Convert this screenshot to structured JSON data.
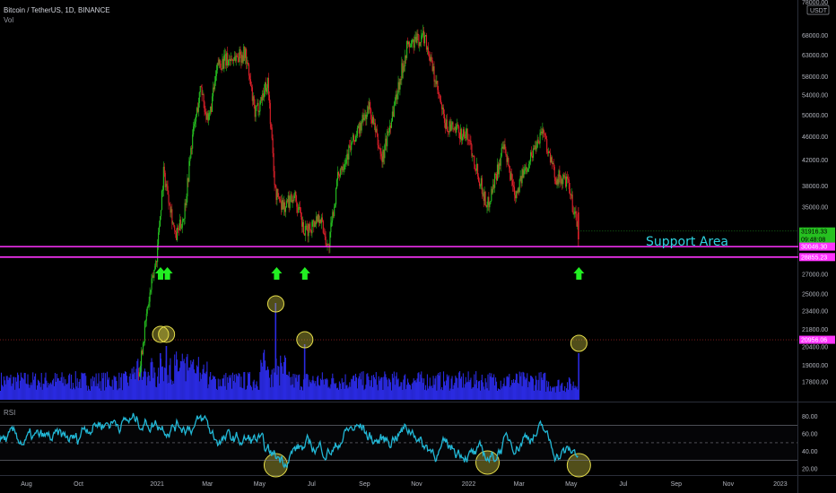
{
  "header": {
    "symbol": "Bitcoin / TetherUS, 1D, BINANCE",
    "volume_label": "Vol",
    "rsi_label": "RSI"
  },
  "price_axis": {
    "currency_badge": "USDT",
    "top_label": "78000.00",
    "ticks": [
      "68000.00",
      "63000.00",
      "58000.00",
      "54000.00",
      "50000.00",
      "46000.00",
      "42000.00",
      "38000.00",
      "35000.00",
      "27000.00",
      "25000.00",
      "23400.00",
      "21800.00",
      "20400.00",
      "19000.00",
      "17800.00"
    ]
  },
  "price_tags": [
    {
      "value": "31916.33",
      "sub": "09:48:08",
      "color": "#26c020"
    },
    {
      "value": "30046.30",
      "color": "#ff33ff"
    },
    {
      "value": "28855.23",
      "color": "#ff33ff"
    },
    {
      "value": "20956.06",
      "color": "#ff33ff"
    }
  ],
  "annotation": {
    "text": "Support Area",
    "color": "#2fd3e0"
  },
  "rsi_axis": {
    "ticks": [
      "80.00",
      "60.00",
      "40.00",
      "20.00"
    ]
  },
  "time_axis": {
    "labels": [
      "Aug",
      "Oct",
      "2021",
      "Mar",
      "May",
      "Jul",
      "Sep",
      "Nov",
      "2022",
      "Mar",
      "May",
      "Jul",
      "Sep",
      "Nov",
      "2023"
    ]
  },
  "colors": {
    "up": "#26c020",
    "down": "#e0202a",
    "support": "#ff33ff",
    "volume": "#2a2ae0",
    "rsi": "#22b8d6",
    "circle": "#e8e04a",
    "arrow": "#22ee22"
  },
  "arrows": [
    {
      "date_label": "early 2021"
    },
    {
      "date_label": "early 2021"
    },
    {
      "date_label": "May 2021"
    },
    {
      "date_label": "Jun 2021"
    },
    {
      "date_label": "May 2022"
    }
  ],
  "chart_data": {
    "type": "candlestick",
    "title": "Bitcoin / TetherUS, 1D, BINANCE",
    "x_range": [
      "2020-07",
      "2023-01"
    ],
    "y_range": [
      16500,
      78000
    ],
    "support_levels": [
      30046.3,
      28855.23
    ],
    "close_path": [
      [
        "2020-12-10",
        18500
      ],
      [
        "2020-12-20",
        23500
      ],
      [
        "2020-12-31",
        29000
      ],
      [
        "2021-01-08",
        40000
      ],
      [
        "2021-01-15",
        36000
      ],
      [
        "2021-01-22",
        31000
      ],
      [
        "2021-02-01",
        34000
      ],
      [
        "2021-02-10",
        45000
      ],
      [
        "2021-02-21",
        56000
      ],
      [
        "2021-03-01",
        48000
      ],
      [
        "2021-03-13",
        61000
      ],
      [
        "2021-04-14",
        63500
      ],
      [
        "2021-04-25",
        50000
      ],
      [
        "2021-05-10",
        57000
      ],
      [
        "2021-05-19",
        37000
      ],
      [
        "2021-05-30",
        35000
      ],
      [
        "2021-06-10",
        37000
      ],
      [
        "2021-06-22",
        31500
      ],
      [
        "2021-07-10",
        34000
      ],
      [
        "2021-07-20",
        29800
      ],
      [
        "2021-08-01",
        40000
      ],
      [
        "2021-09-06",
        51500
      ],
      [
        "2021-09-21",
        42000
      ],
      [
        "2021-10-20",
        65000
      ],
      [
        "2021-11-10",
        68000
      ],
      [
        "2021-12-04",
        48000
      ],
      [
        "2021-12-31",
        46000
      ],
      [
        "2022-01-22",
        35000
      ],
      [
        "2022-02-10",
        44000
      ],
      [
        "2022-02-24",
        37000
      ],
      [
        "2022-03-28",
        47500
      ],
      [
        "2022-04-11",
        39500
      ],
      [
        "2022-04-26",
        38500
      ],
      [
        "2022-05-09",
        31916.33
      ]
    ],
    "volume_spike_value": 20956.06,
    "rsi": {
      "levels": [
        70,
        50,
        30
      ],
      "range": [
        15,
        90
      ]
    }
  }
}
